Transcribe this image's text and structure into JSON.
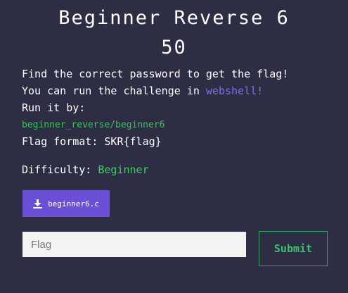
{
  "challenge": {
    "title": "Beginner Reverse 6",
    "points": "50"
  },
  "description": {
    "line1": "Find the correct password to get the flag!",
    "line2_prefix": "You can run the challenge in ",
    "line2_link": "webshell!",
    "line3": "Run it by:",
    "command": "beginner_reverse/beginner6",
    "flag_format": "Flag format: SKR{flag}"
  },
  "difficulty": {
    "label": "Difficulty: ",
    "value": "Beginner"
  },
  "download": {
    "label": "beginner6.c",
    "icon": "download-icon"
  },
  "form": {
    "flag_placeholder": "Flag",
    "flag_value": "",
    "submit_label": "Submit"
  },
  "colors": {
    "background": "#2d2d44",
    "link": "#7c6ef2",
    "accent_green": "#3fcf5f",
    "button_purple": "#6b4fd6"
  }
}
